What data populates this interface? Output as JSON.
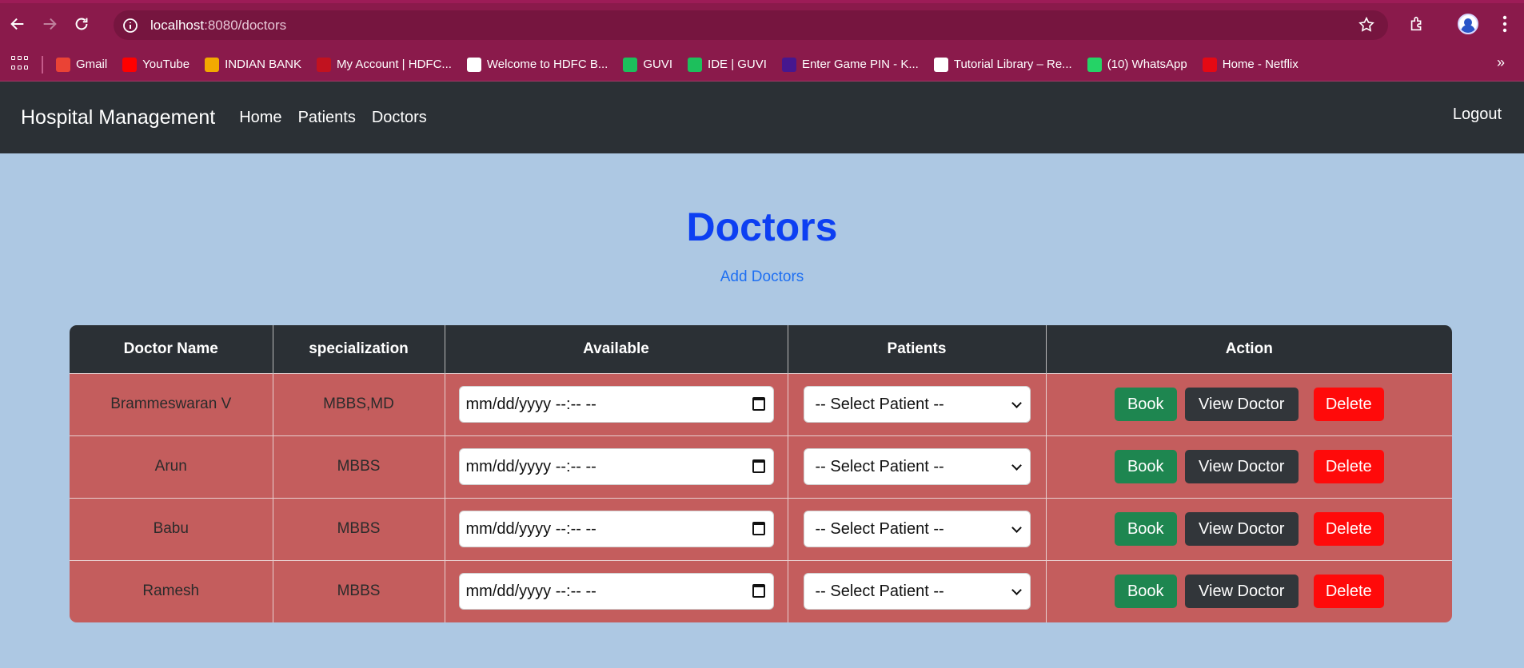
{
  "browser": {
    "url_host": "localhost",
    "url_path": ":8080/doctors",
    "bookmarks": [
      {
        "label": "Gmail",
        "color": "#ea4335"
      },
      {
        "label": "YouTube",
        "color": "#ff0000"
      },
      {
        "label": "INDIAN BANK",
        "color": "#f2a900"
      },
      {
        "label": "My Account | HDFC...",
        "color": "#c1121f"
      },
      {
        "label": "Welcome to HDFC B...",
        "color": "#ffffff"
      },
      {
        "label": "GUVI",
        "color": "#1dbf5c"
      },
      {
        "label": "IDE | GUVI",
        "color": "#1dbf5c"
      },
      {
        "label": "Enter Game PIN - K...",
        "color": "#46178f"
      },
      {
        "label": "Tutorial Library – Re...",
        "color": "#ffffff"
      },
      {
        "label": "(10) WhatsApp",
        "color": "#25d366"
      },
      {
        "label": "Home - Netflix",
        "color": "#e50914"
      }
    ]
  },
  "navbar": {
    "brand": "Hospital Management",
    "links": [
      "Home",
      "Patients",
      "Doctors"
    ],
    "logout": "Logout"
  },
  "page": {
    "title": "Doctors",
    "add_link": "Add Doctors"
  },
  "table": {
    "headers": [
      "Doctor Name",
      "specialization",
      "Available",
      "Patients",
      "Action"
    ],
    "date_placeholder": "mm/dd/yyyy --:-- --",
    "select_placeholder": "-- Select Patient --",
    "actions": {
      "book": "Book",
      "view": "View Doctor",
      "delete": "Delete"
    },
    "rows": [
      {
        "name": "Brammeswaran V",
        "specialization": "MBBS,MD"
      },
      {
        "name": "Arun",
        "specialization": "MBBS"
      },
      {
        "name": "Babu",
        "specialization": "MBBS"
      },
      {
        "name": "Ramesh",
        "specialization": "MBBS"
      }
    ]
  },
  "colors": {
    "browser_frame": "#8a1a4b",
    "navbar": "#2b3035",
    "page_bg": "#adc8e3",
    "row_bg": "#c45d5d",
    "title": "#0d3ff2",
    "book": "#1e8650",
    "view": "#32363a",
    "delete": "#ff0a0a"
  }
}
